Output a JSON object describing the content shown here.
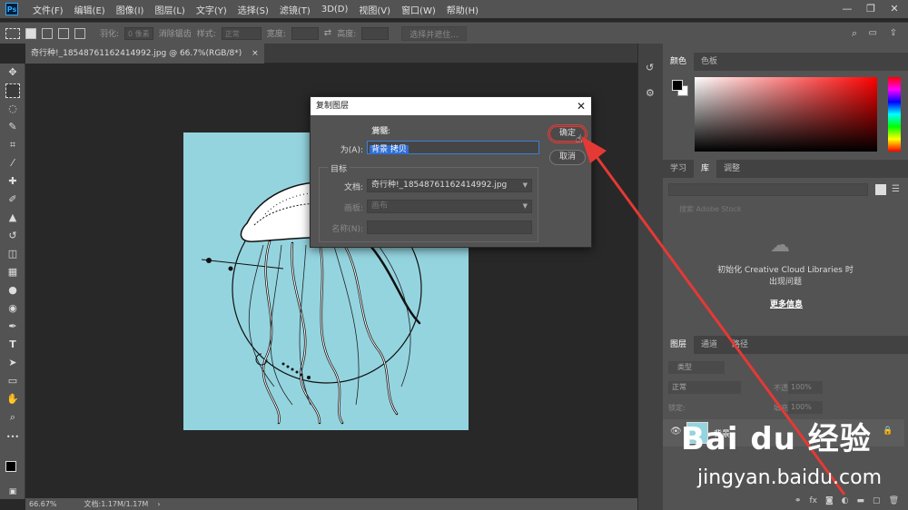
{
  "app": {
    "logo_text": "Ps"
  },
  "menu": [
    "文件(F)",
    "编辑(E)",
    "图像(I)",
    "图层(L)",
    "文字(Y)",
    "选择(S)",
    "滤镜(T)",
    "3D(D)",
    "视图(V)",
    "窗口(W)",
    "帮助(H)"
  ],
  "options": {
    "feather_label": "羽化:",
    "feather_value": "0 像素",
    "antialias_label": "消除锯齿",
    "style_label": "样式:",
    "style_value": "正常",
    "width_label": "宽度:",
    "height_label": "高度:",
    "select_mask_label": "选择并遮住..."
  },
  "document": {
    "tab_title": "奇行种!_18548761162414992.jpg @ 66.7%(RGB/8*)",
    "tab_close": "×"
  },
  "status": {
    "zoom": "66.67%",
    "doc_size": "文档:1.17M/1.17M"
  },
  "dialog": {
    "title": "复制图层",
    "duplicate_label": "复制:",
    "duplicate_value": "背景",
    "as_label": "为(A):",
    "as_value": "背景 拷贝",
    "ok_label": "确定",
    "cancel_label": "取消",
    "dest_group": "目标",
    "document_label": "文档:",
    "document_value": "奇行种!_18548761162414992.jpg",
    "artboard_label": "画板:",
    "artboard_value": "画布",
    "name_label": "名称(N):"
  },
  "panels": {
    "color_tabs": [
      "颜色",
      "色板"
    ],
    "lib_tabs": [
      "学习",
      "库",
      "调整"
    ],
    "lib_search_placeholder": "搜索 Adobe Stock",
    "lib_error": "初始化 Creative Cloud Libraries 时出现问题",
    "lib_more": "更多信息",
    "layer_tabs": [
      "图层",
      "通道",
      "路径"
    ],
    "layer_kind": "类型",
    "blend_mode": "正常",
    "opacity_label": "不透明度:",
    "opacity_value": "100%",
    "lock_label": "锁定:",
    "fill_label": "填充:",
    "fill_value": "100%",
    "layer_name": "背景"
  },
  "watermark": {
    "main": "Bai du 经验",
    "sub": "jingyan.baidu.com"
  },
  "colors": {
    "accent": "#e53935",
    "canvas_bg": "#94d4df",
    "selection": "#2f6fd6"
  }
}
